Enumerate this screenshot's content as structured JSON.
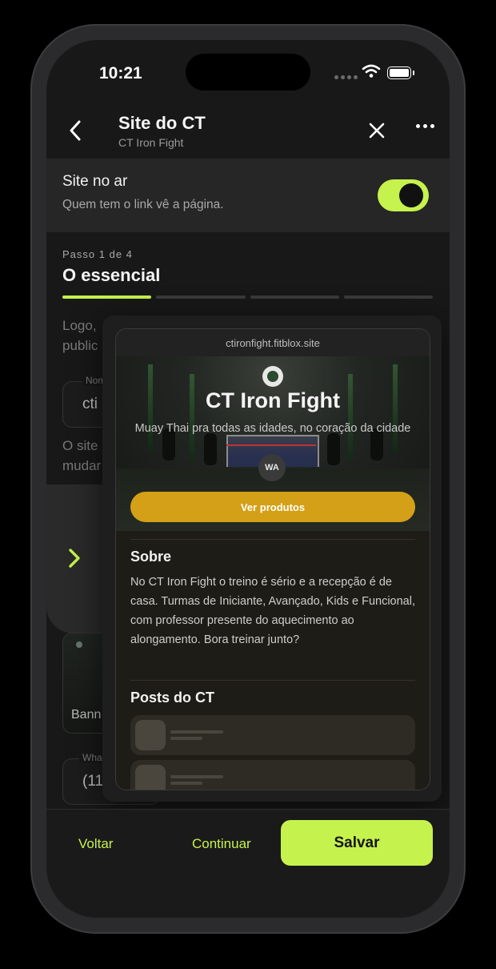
{
  "status_bar": {
    "time": "10:21"
  },
  "header": {
    "title": "Site do CT",
    "subtitle": "CT Iron Fight"
  },
  "live": {
    "title": "Site no ar",
    "subtitle": "Quem tem o link vê a página.",
    "enabled": true
  },
  "wizard": {
    "step_label": "Passo 1 de 4",
    "step_title": "O essencial",
    "current_step": 1,
    "total_steps": 4
  },
  "background_form": {
    "intro_line1": "Logo,",
    "intro_line2": "public",
    "name_label": "Nom",
    "name_value": "cti",
    "note_line1": "O site",
    "note_line2": "mudar",
    "banner_label": "Bann",
    "whatsapp_label": "Wha",
    "whatsapp_value": "(11"
  },
  "preview": {
    "url": "ctironfight.fitblox.site",
    "hero_title": "CT Iron Fight",
    "hero_subtitle": "Muay Thai pra todas as idades, no coração da cidade",
    "whatsapp_badge": "WA",
    "cta_label": "Ver produtos",
    "about_title": "Sobre",
    "about_text": "No CT Iron Fight o treino é sério e a recepção é de casa. Turmas de Iniciante, Avançado, Kids e Funcional, com professor presente do aquecimento ao alongamento. Bora treinar junto?",
    "posts_title": "Posts do CT",
    "accent_color": "#d4a017"
  },
  "footer": {
    "back_label": "Voltar",
    "continue_label": "Continuar",
    "save_label": "Salvar"
  },
  "colors": {
    "accent": "#c6f24d",
    "background": "#181818"
  }
}
